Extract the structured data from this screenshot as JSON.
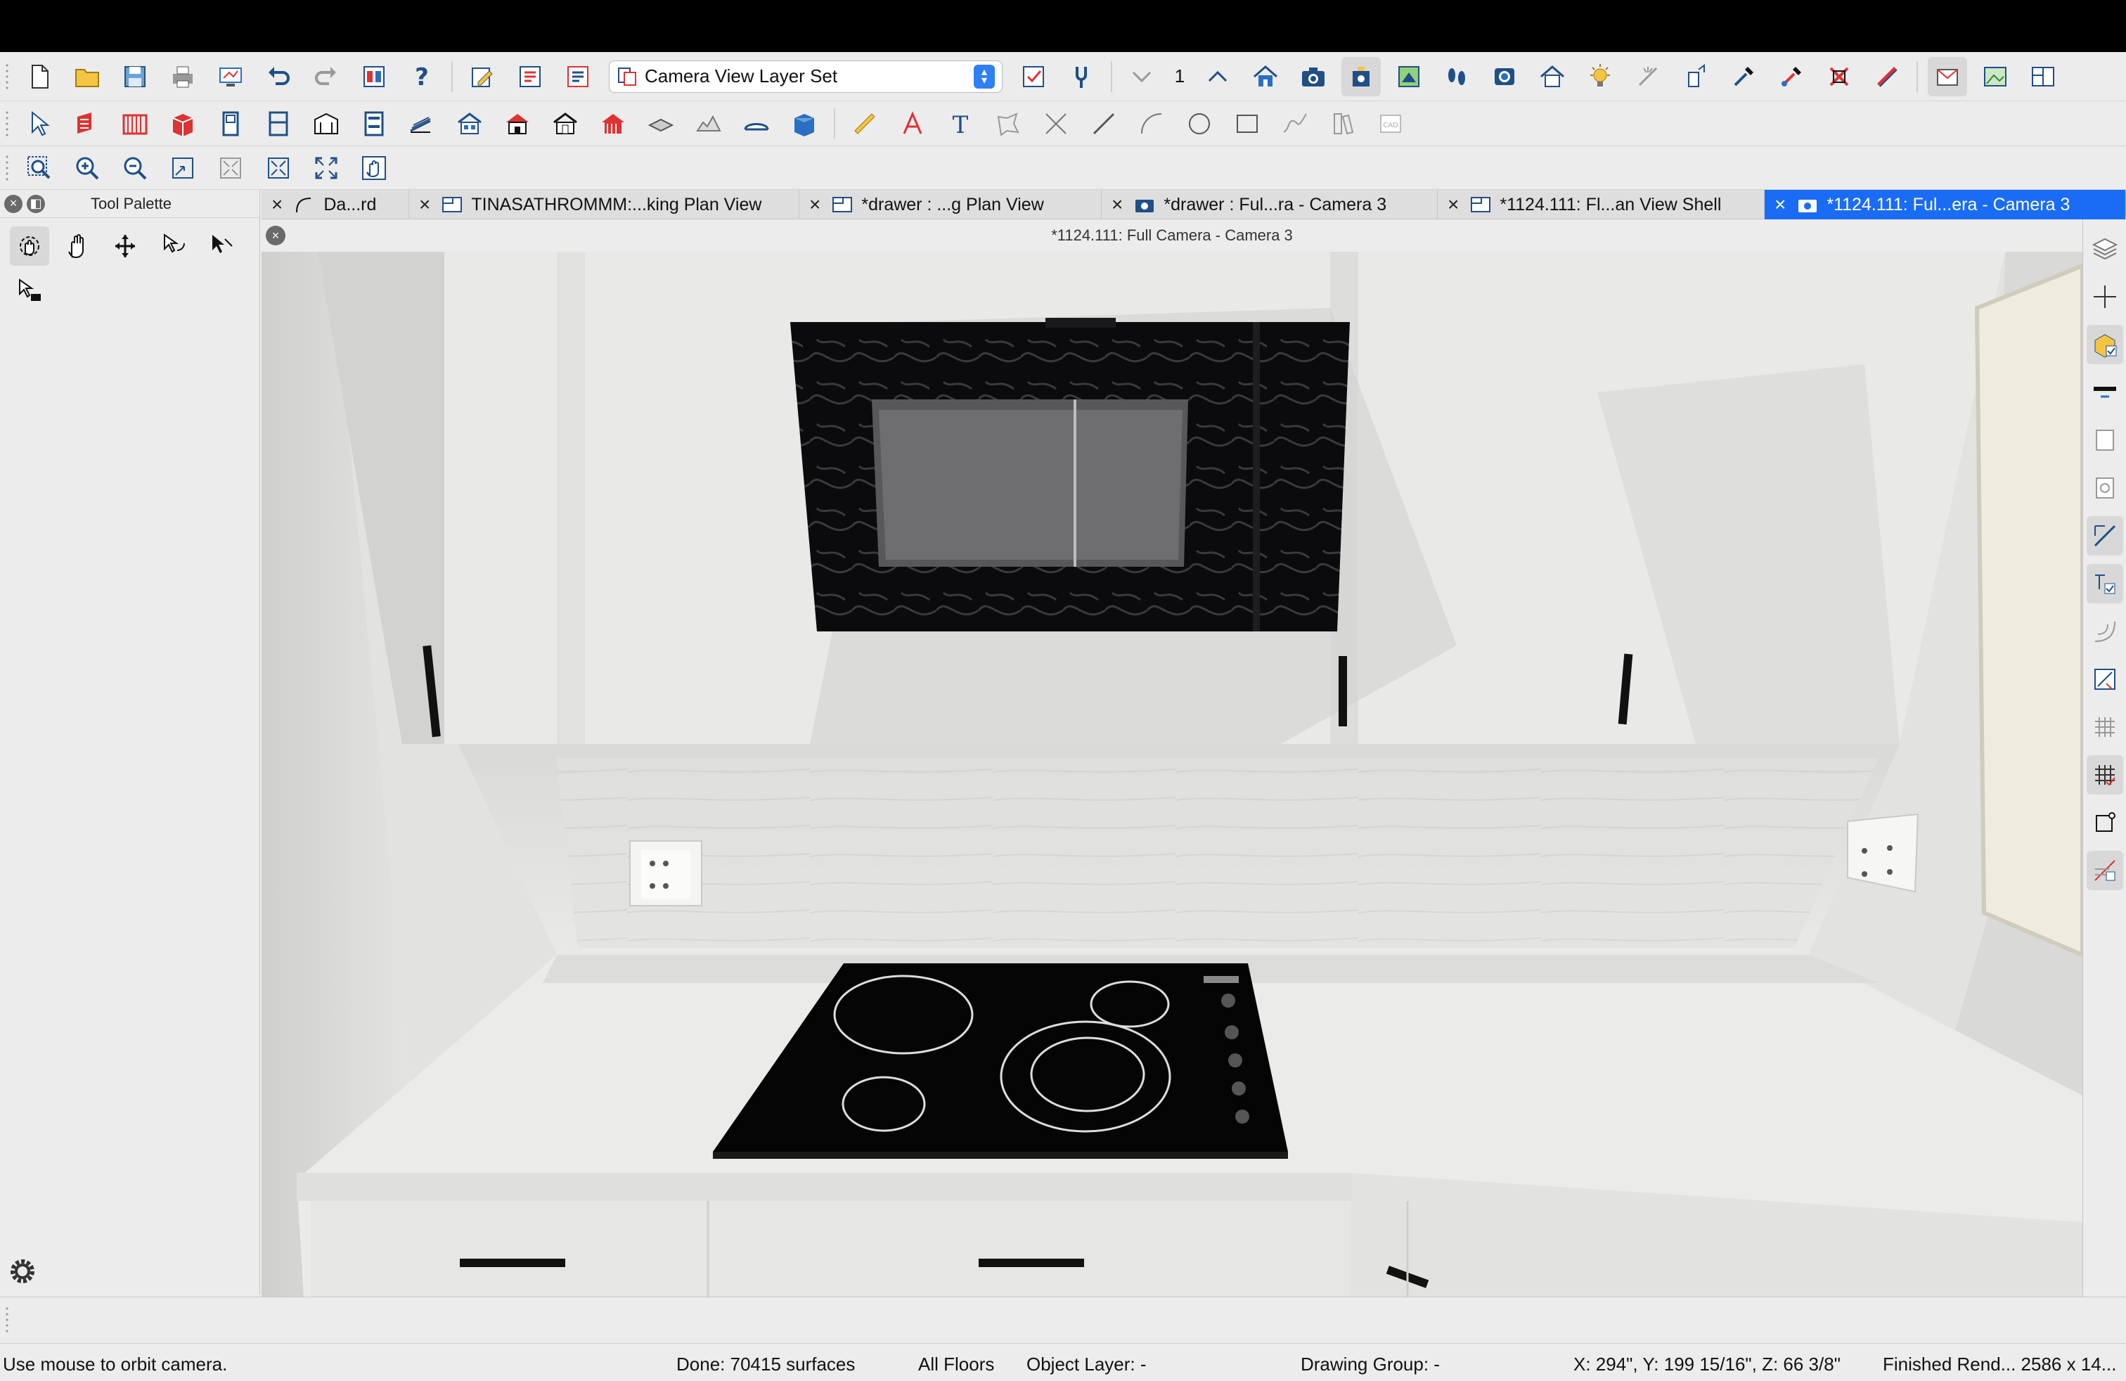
{
  "window": {
    "view_title": "*1124.111: Full Camera - Camera 3"
  },
  "toolbar": {
    "layer_set": "Camera View Layer Set",
    "floor_number": "1"
  },
  "palette": {
    "title": "Tool Palette"
  },
  "tabs": [
    {
      "label": "Da...rd",
      "icon": "drawing-icon",
      "active": false
    },
    {
      "label": "TINASATHROMMM:...king Plan View",
      "icon": "plan-view-icon",
      "active": false
    },
    {
      "label": "*drawer : ...g Plan View",
      "icon": "plan-view-icon",
      "active": false
    },
    {
      "label": "*drawer : Ful...ra - Camera 3",
      "icon": "camera-icon",
      "active": false
    },
    {
      "label": "*1124.111: Fl...an View Shell",
      "icon": "plan-view-icon",
      "active": false
    },
    {
      "label": "*1124.111: Ful...era - Camera 3",
      "icon": "camera-icon",
      "active": true
    }
  ],
  "status": {
    "hint": "Use mouse to orbit camera.",
    "done": "Done:  70415 surfaces",
    "floors": "All Floors",
    "object_layer": "Object Layer: -",
    "drawing_group": "Drawing Group: -",
    "coords": "X: 294\", Y: 199 15/16\", Z: 66 3/8\"",
    "render": "Finished Rend...  2586 x 14..."
  },
  "colors": {
    "accent": "#1a6cf4",
    "toolbar_bg": "#ececec",
    "cabinet": "#ececea",
    "cooktop": "#050505"
  },
  "icons": {
    "toolbar1": [
      "new-file-icon",
      "open-folder-icon",
      "save-icon",
      "print-icon",
      "plot-icon",
      "undo-icon",
      "redo-icon",
      "layer-display-icon",
      "help-icon",
      "edit-layer-icon",
      "layer-set-icon",
      "layer-set-alt-icon",
      "layer-set-dropdown",
      "layer-checkbox-icon",
      "layer-tool-icon",
      "floor-down-icon",
      "floor-number",
      "floor-up-icon",
      "home-icon",
      "camera-icon",
      "camera-tool-icon",
      "render-icon",
      "walkthrough-icon",
      "record-icon",
      "house-icon",
      "light-icon",
      "sun-icon",
      "measure-icon",
      "dropper-icon",
      "material-icon",
      "delete-icon",
      "ruler-icon",
      "export-icon",
      "image-icon",
      "layout-icon"
    ],
    "toolbar2": [
      "select-icon",
      "wall-icon",
      "railing-icon",
      "cabinet-icon",
      "door-icon",
      "window-icon",
      "shelf-icon",
      "appliance-icon",
      "stairs-icon",
      "roof-icon",
      "building-icon",
      "framing-icon",
      "home-fill-icon",
      "slab-icon",
      "terrain-icon",
      "room-icon",
      "box-icon",
      "dimension-icon",
      "text-arrow-icon",
      "text-icon",
      "polyline-icon",
      "cross-icon",
      "line-icon",
      "arc-icon",
      "circle-icon",
      "rectangle-icon",
      "spline-icon",
      "library-icon",
      "cad-icon"
    ],
    "toolbar3": [
      "zoom-window-icon",
      "zoom-in-icon",
      "zoom-out-icon",
      "zoom-fit-icon",
      "fill-window-icon",
      "zoom-all-icon",
      "fullscreen-icon",
      "pan-icon"
    ],
    "palette": [
      "orbit-camera-icon",
      "pan-camera-icon",
      "move-camera-icon",
      "tilt-camera-icon",
      "select-camera-icon",
      "camera-settings-icon"
    ],
    "right": [
      "layers-icon",
      "plus-icon",
      "material-check-icon",
      "divider-icon",
      "frame-icon",
      "magnify-icon",
      "line-edit-icon",
      "snap-icon",
      "curve-icon",
      "zoom-edit-icon",
      "grid-icon",
      "grid-check-icon",
      "shape-icon",
      "layer-check-icon"
    ]
  }
}
